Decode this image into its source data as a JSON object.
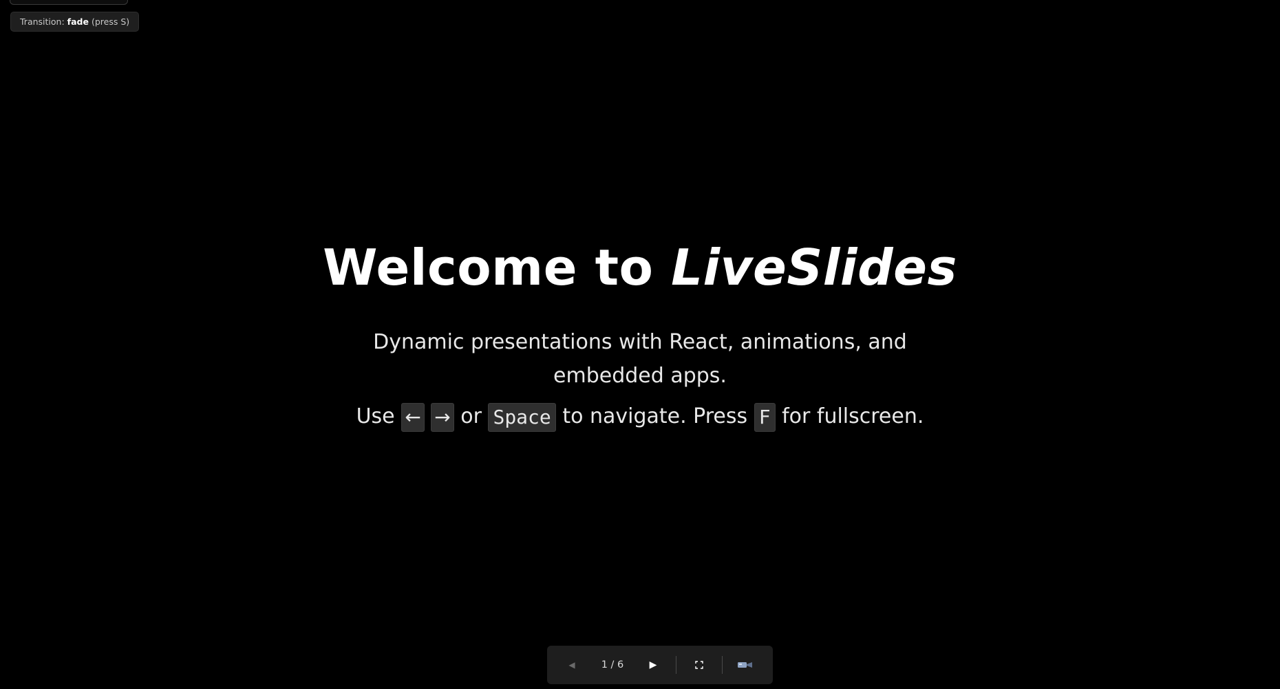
{
  "transition": {
    "prefix": "Transition:",
    "mode": "fade",
    "suffix": "(press S)"
  },
  "slide": {
    "title_plain": "Welcome to",
    "title_emphasis": "LiveSlides",
    "subtitle": "Dynamic presentations with React, animations, and embedded apps.",
    "hint_use": "Use",
    "key_left": "←",
    "key_right": "→",
    "hint_or": "or",
    "key_space": "Space",
    "hint_navigate": "to navigate. Press",
    "key_f": "F",
    "hint_fullscreen": "for fullscreen."
  },
  "controls": {
    "prev_icon": "prev-triangle-icon",
    "prev_glyph": "◀",
    "page_indicator": "1 / 6",
    "next_icon": "next-triangle-icon",
    "next_glyph": "▶",
    "fullscreen_icon": "fullscreen-icon",
    "camera_icon": "video-camera-icon",
    "camera_glyph": "📹"
  },
  "colors": {
    "background": "#000000",
    "text": "#ffffff",
    "control_bar": "#1e1e1e",
    "kbd_bg": "#2f2f2f"
  }
}
